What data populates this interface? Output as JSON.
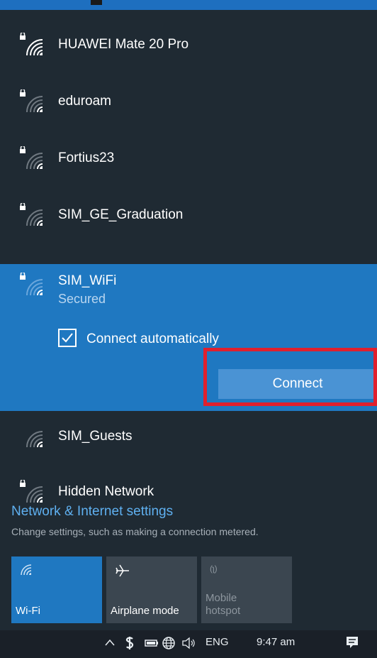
{
  "networks": [
    {
      "name": "HUAWEI Mate 20 Pro",
      "secured": true
    },
    {
      "name": "eduroam",
      "secured": true
    },
    {
      "name": "Fortius23",
      "secured": true
    },
    {
      "name": "SIM_GE_Graduation",
      "secured": true
    }
  ],
  "selected_network": {
    "name": "SIM_WiFi",
    "status": "Secured",
    "auto_connect_label": "Connect automatically",
    "auto_connect_checked": true,
    "connect_label": "Connect"
  },
  "networks_below": [
    {
      "name": "SIM_Guests",
      "secured": false
    },
    {
      "name": "Hidden Network",
      "secured": true
    }
  ],
  "settings": {
    "title": "Network & Internet settings",
    "subtitle": "Change settings, such as making a connection metered."
  },
  "quick_actions": {
    "wifi": "Wi-Fi",
    "airplane": "Airplane mode",
    "hotspot": "Mobile\nhotspot",
    "hotspot_icon_text": "(ʅ)"
  },
  "taskbar": {
    "language": "ENG",
    "time": "9:47 am"
  },
  "colors": {
    "panel": "#1f2a33",
    "accent": "#1f78c1",
    "button": "#4a93d4",
    "highlight": "#e0202e",
    "link": "#5fb0f0"
  }
}
